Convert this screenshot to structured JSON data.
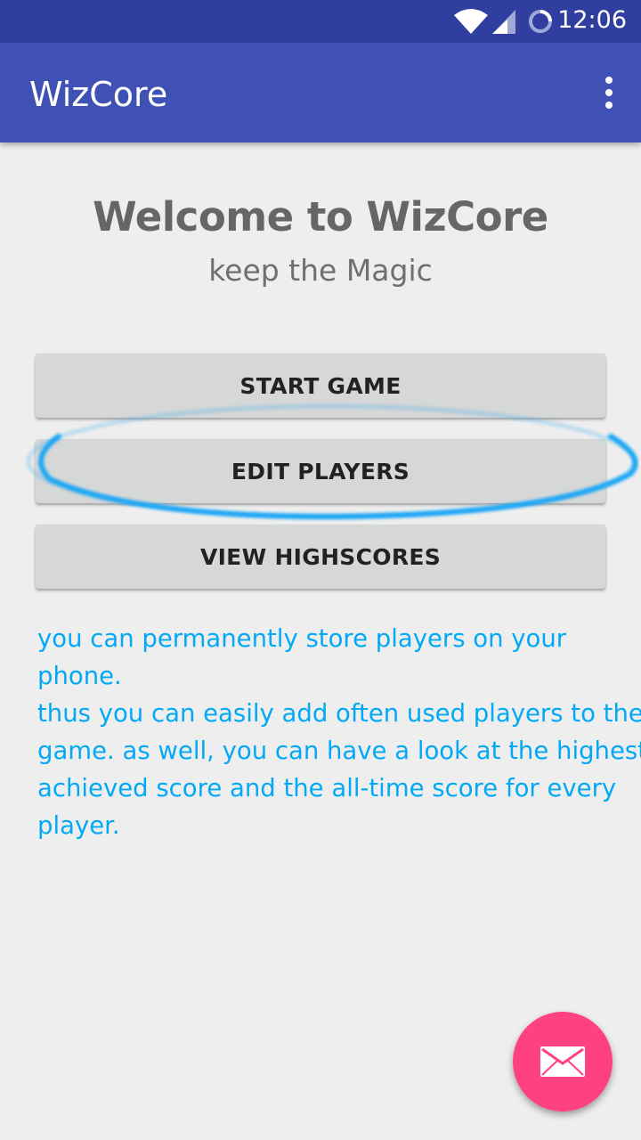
{
  "status_bar": {
    "time": "12:06",
    "icons": [
      "wifi-icon",
      "cell-signal-icon",
      "sync-icon"
    ]
  },
  "app_bar": {
    "title": "WizCore",
    "overflow_icon": "more-vert-icon",
    "color": "#3f51b5"
  },
  "header": {
    "welcome": "Welcome to WizCore",
    "tagline": "keep the Magic"
  },
  "buttons": {
    "start_game": "START GAME",
    "edit_players": "EDIT PLAYERS",
    "view_highscores": "VIEW HIGHSCORES"
  },
  "info_text": "you can permanently store players on your phone.\nthus you can easily add often used players to the\ngame. as well, you can have a look at the highest\nachieved score and the all-time score for every\nplayer.",
  "fab": {
    "icon": "email-icon",
    "color": "#ff4081"
  },
  "colors": {
    "status_bar": "#303f9f",
    "accent_text": "#03a9f4",
    "highlight": "#2aa8f2"
  }
}
